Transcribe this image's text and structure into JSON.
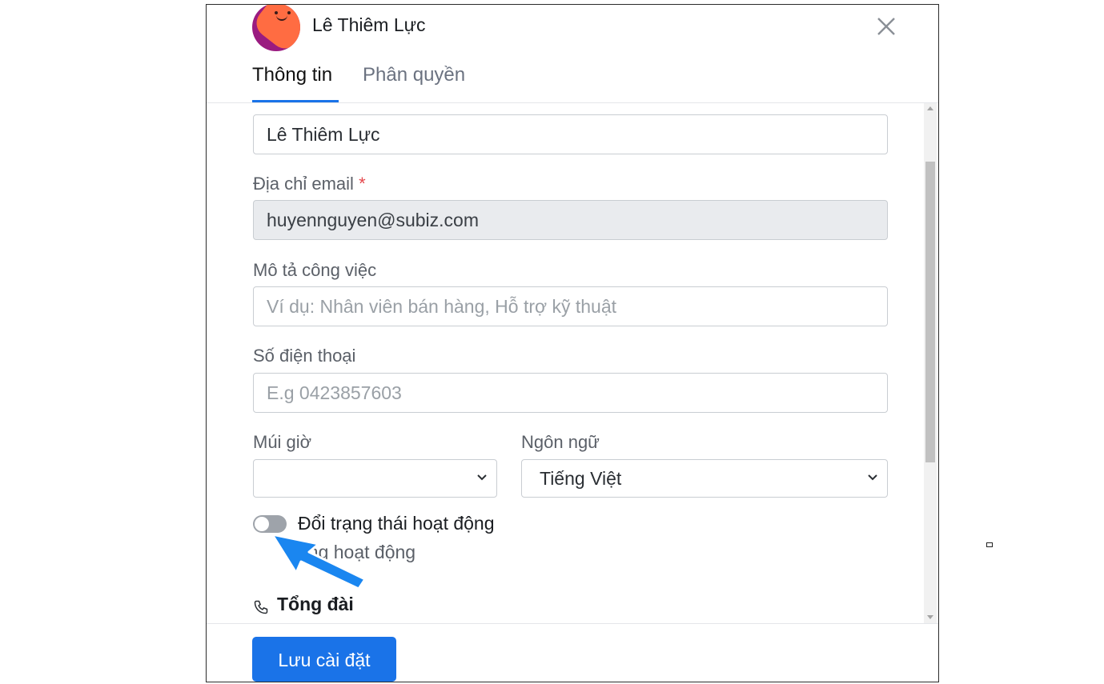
{
  "header": {
    "user_name": "Lê Thiêm Lực",
    "tabs": [
      {
        "label": "Thông tin",
        "active": true
      },
      {
        "label": "Phân quyền",
        "active": false
      }
    ]
  },
  "form": {
    "name_value": "Lê Thiêm Lực",
    "email_label": "Địa chỉ email",
    "email_required_mark": "*",
    "email_value": "huyennguyen@subiz.com",
    "job_label": "Mô tả công việc",
    "job_placeholder": "Ví dụ: Nhân viên bán hàng, Hỗ trợ kỹ thuật",
    "phone_label": "Số điện thoại",
    "phone_placeholder": "E.g 0423857603",
    "timezone_label": "Múi giờ",
    "timezone_value": "",
    "language_label": "Ngôn ngữ",
    "language_value": "Tiếng Việt",
    "status_toggle_label": "Đổi trạng thái hoạt động",
    "status_toggle_on": false,
    "status_sub_label": "ông hoạt động",
    "section_title": "Tổng đài"
  },
  "footer": {
    "save_label": "Lưu cài đặt"
  },
  "colors": {
    "accent": "#1a73e8",
    "arrow": "#1a86f0"
  }
}
